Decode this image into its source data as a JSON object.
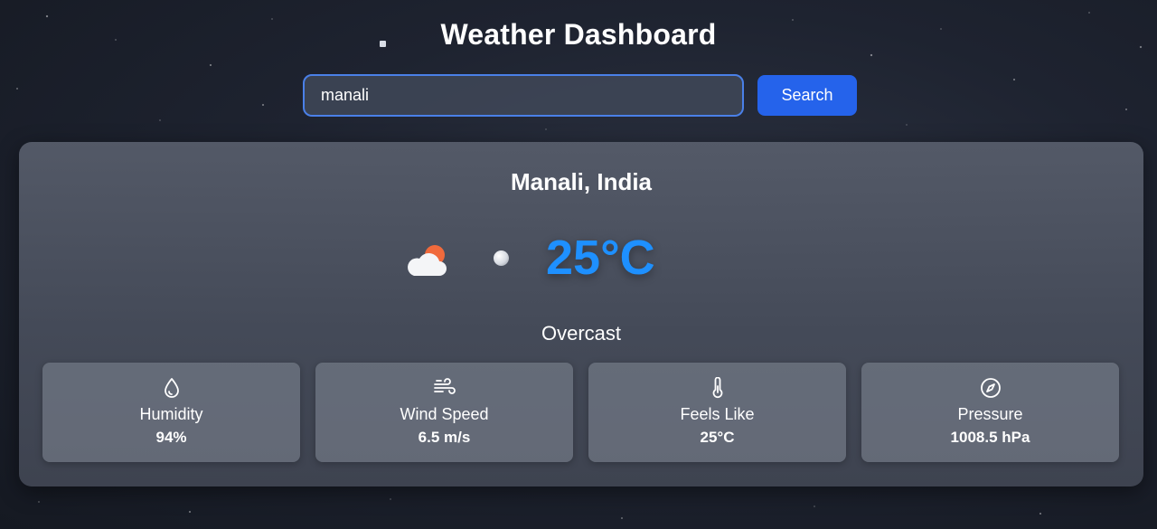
{
  "header": {
    "title": "Weather Dashboard"
  },
  "search": {
    "value": "manali",
    "placeholder": "Enter city name",
    "button_label": "Search"
  },
  "weather": {
    "location": "Manali, India",
    "icon": "partly-cloudy-icon",
    "temperature": "25°C",
    "condition": "Overcast"
  },
  "stats": [
    {
      "icon": "humidity-icon",
      "label": "Humidity",
      "value": "94%"
    },
    {
      "icon": "wind-icon",
      "label": "Wind Speed",
      "value": "6.5 m/s"
    },
    {
      "icon": "thermometer-icon",
      "label": "Feels Like",
      "value": "25°C"
    },
    {
      "icon": "compass-icon",
      "label": "Pressure",
      "value": "1008.5 hPa"
    }
  ],
  "colors": {
    "accent": "#2563eb",
    "temperature": "#1e90ff",
    "background": "#1e2330"
  }
}
